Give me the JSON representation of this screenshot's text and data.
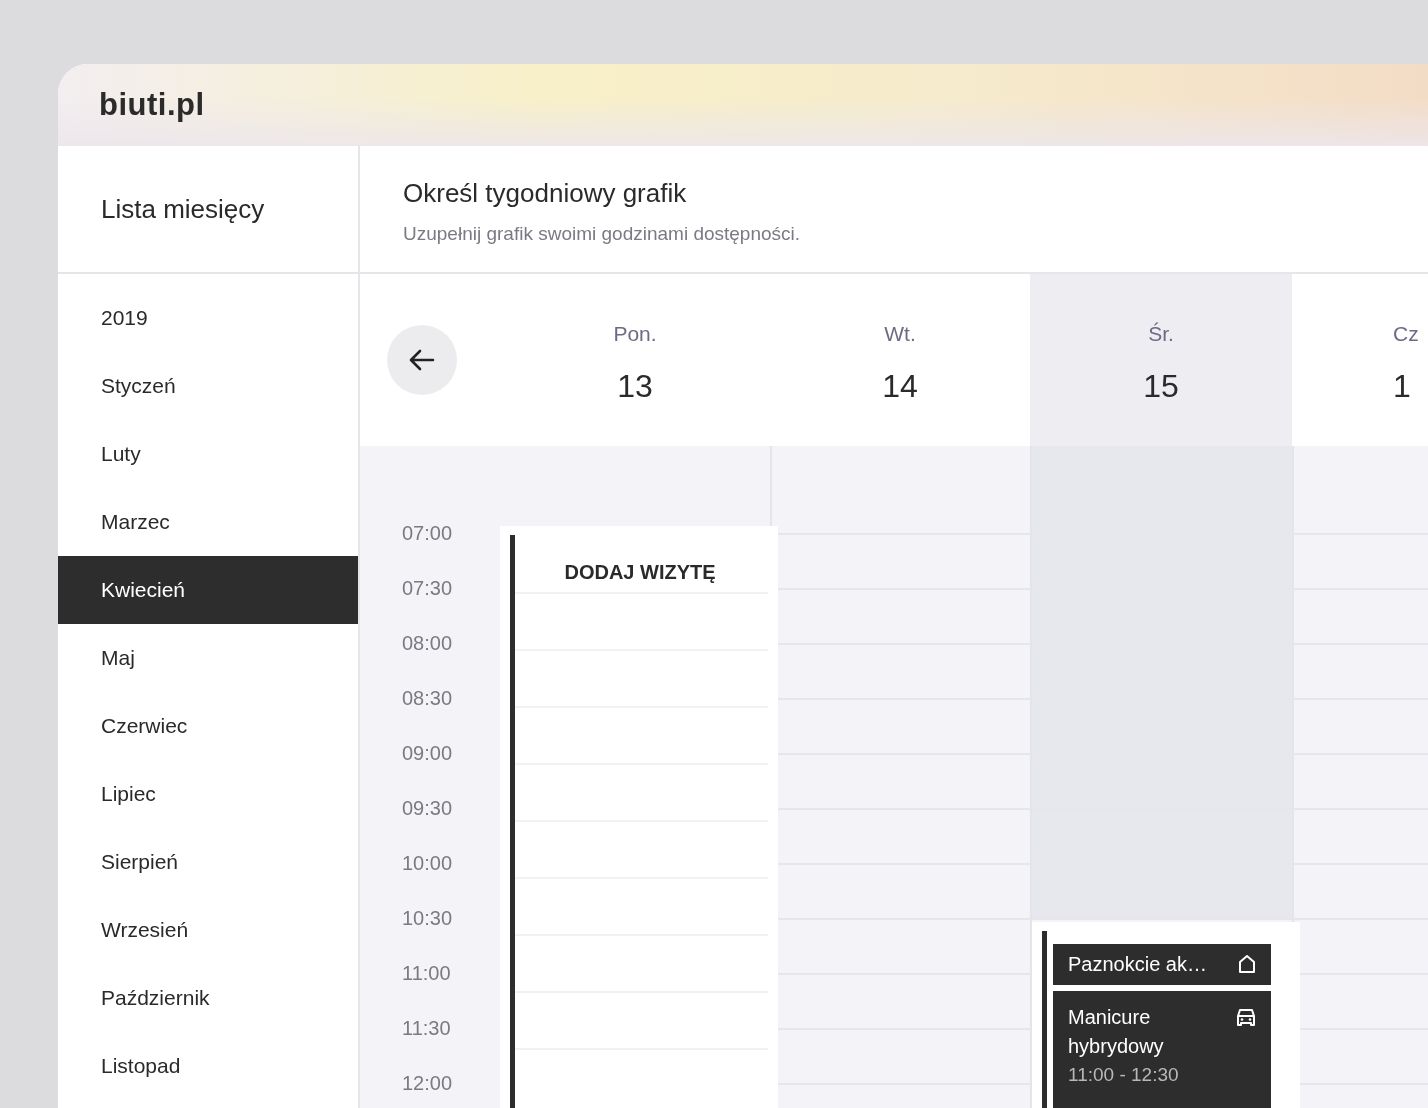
{
  "app": {
    "logo": "biuti.pl"
  },
  "sidebar": {
    "title": "Lista miesięcy",
    "items": [
      {
        "label": "2019",
        "selected": false
      },
      {
        "label": "Styczeń",
        "selected": false
      },
      {
        "label": "Luty",
        "selected": false
      },
      {
        "label": "Marzec",
        "selected": false
      },
      {
        "label": "Kwiecień",
        "selected": true
      },
      {
        "label": "Maj",
        "selected": false
      },
      {
        "label": "Czerwiec",
        "selected": false
      },
      {
        "label": "Lipiec",
        "selected": false
      },
      {
        "label": "Sierpień",
        "selected": false
      },
      {
        "label": "Wrzesień",
        "selected": false
      },
      {
        "label": "Październik",
        "selected": false
      },
      {
        "label": "Listopad",
        "selected": false
      }
    ]
  },
  "header": {
    "title": "Określ tygodniowy grafik",
    "subtitle": "Uzupełnij grafik swoimi godzinami dostępności."
  },
  "days": [
    {
      "name": "Pon.",
      "date": "13",
      "selected": false,
      "slot": {
        "kind": "add",
        "label": "DODAJ WIZYTĘ"
      }
    },
    {
      "name": "Wt.",
      "date": "14",
      "selected": false
    },
    {
      "name": "Śr.",
      "date": "15",
      "selected": true,
      "slot": {
        "kind": "booked",
        "items": [
          {
            "title": "Paznokcie ak…",
            "kind": "home"
          },
          {
            "title": "Manicure hybrydowy",
            "kind": "car",
            "time": "11:00 - 12:30"
          }
        ]
      }
    },
    {
      "name": "Cz",
      "date": "1",
      "selected": false
    }
  ],
  "times": [
    "07:00",
    "07:30",
    "08:00",
    "08:30",
    "09:00",
    "09:30",
    "10:00",
    "10:30",
    "11:00",
    "11:30",
    "12:00"
  ]
}
